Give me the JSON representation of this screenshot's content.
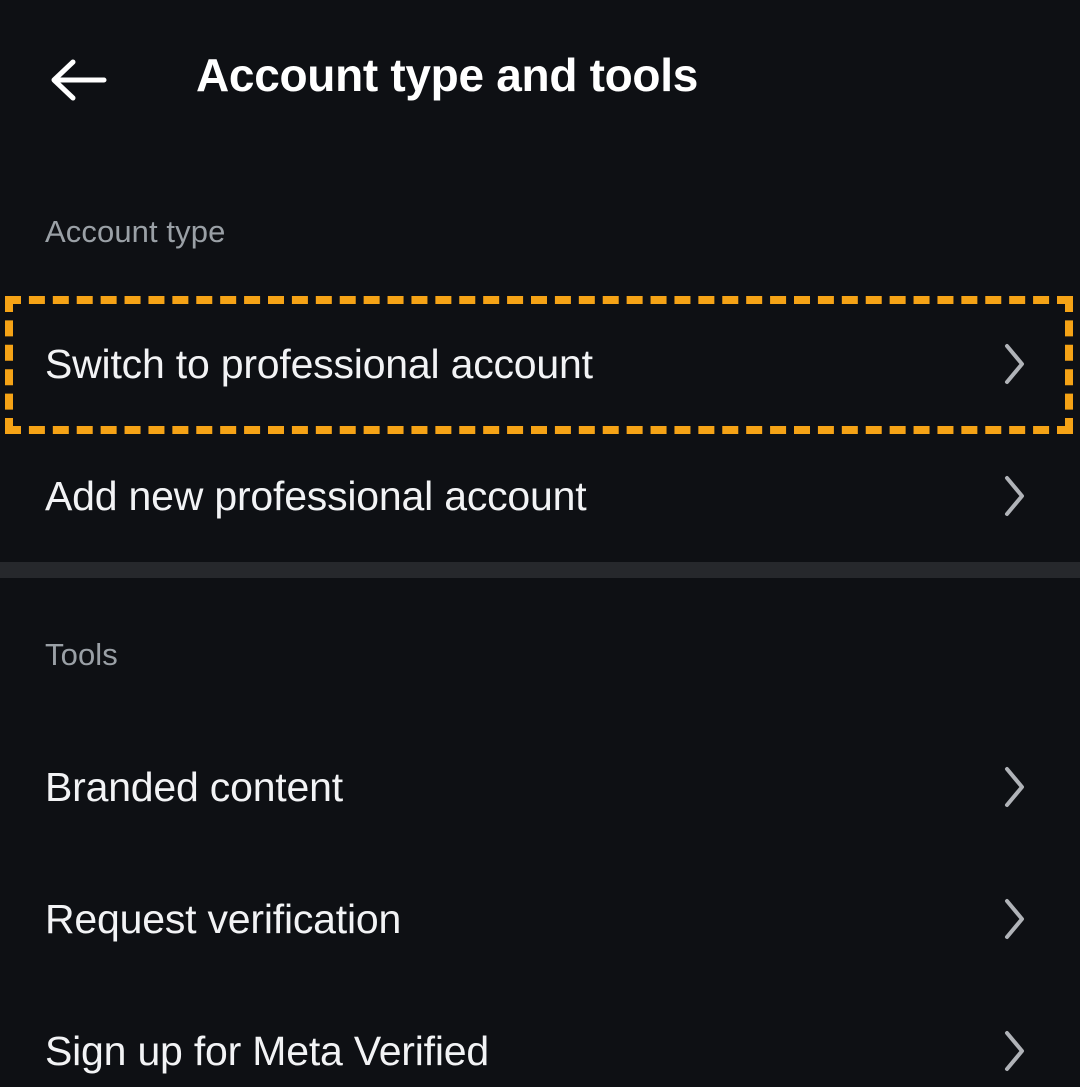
{
  "header": {
    "title": "Account type and tools",
    "back_icon": "back-arrow-icon"
  },
  "sections": [
    {
      "id": "account_type",
      "label": "Account type",
      "items": [
        {
          "label": "Switch to professional account",
          "chevron_icon": "chevron-right-icon",
          "highlighted": true
        },
        {
          "label": "Add new professional account",
          "chevron_icon": "chevron-right-icon",
          "highlighted": false
        }
      ]
    },
    {
      "id": "tools",
      "label": "Tools",
      "items": [
        {
          "label": "Branded content",
          "chevron_icon": "chevron-right-icon",
          "highlighted": false
        },
        {
          "label": "Request verification",
          "chevron_icon": "chevron-right-icon",
          "highlighted": false
        },
        {
          "label": "Sign up for Meta Verified",
          "chevron_icon": "chevron-right-icon",
          "highlighted": false
        }
      ]
    }
  ],
  "colors": {
    "background": "#0e1014",
    "text_primary": "#f2f3f5",
    "text_secondary": "#9aa0a6",
    "chevron": "#b0b3b8",
    "highlight_outline": "#f5a316",
    "divider": "#26282c"
  }
}
